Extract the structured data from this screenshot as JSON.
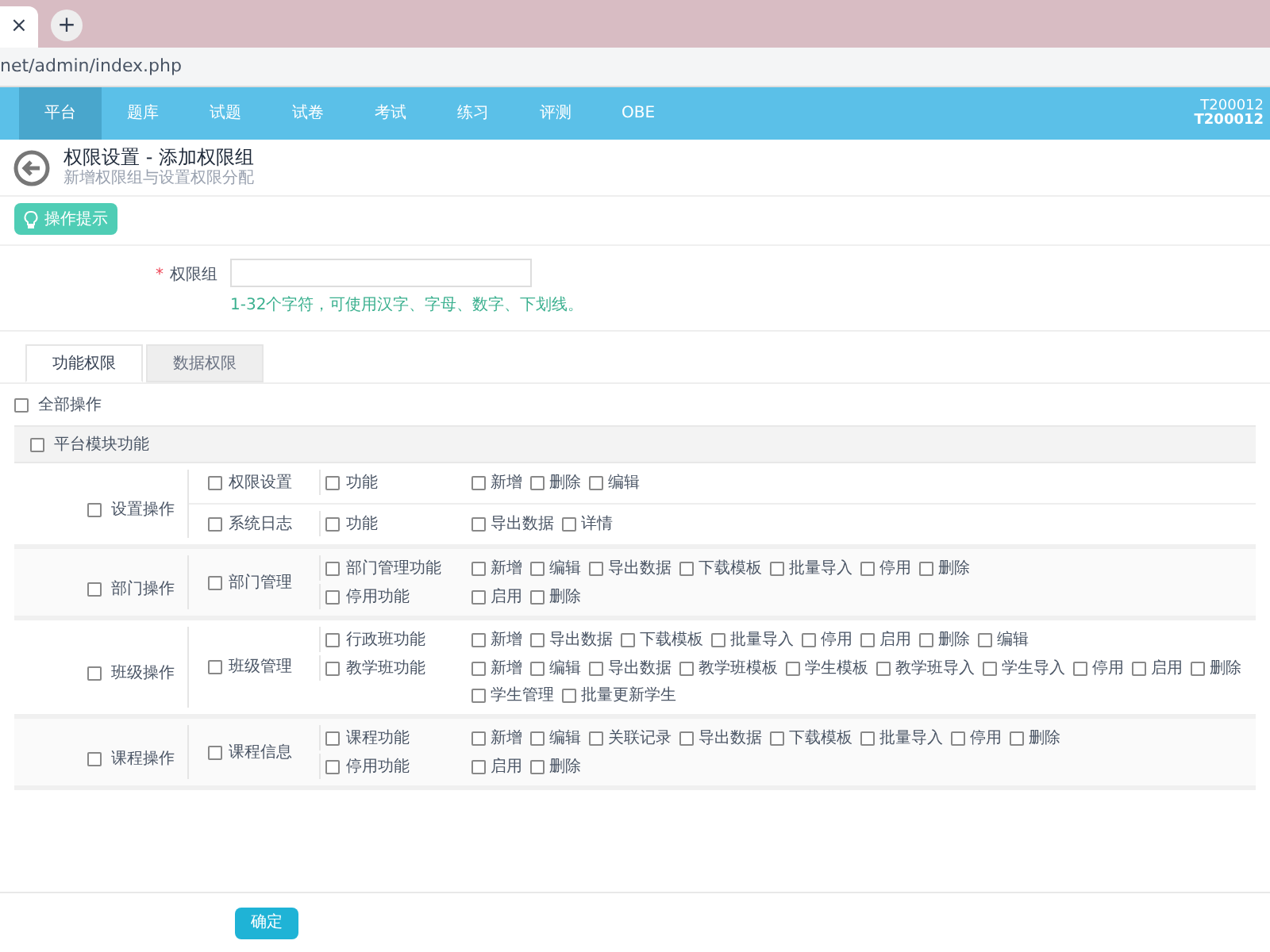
{
  "browser": {
    "tab_close": "×",
    "new_tab": "+",
    "address": "net/admin/index.php"
  },
  "nav": {
    "items": [
      {
        "label": "平台",
        "selected": true
      },
      {
        "label": "题库",
        "selected": false
      },
      {
        "label": "试题",
        "selected": false
      },
      {
        "label": "试卷",
        "selected": false
      },
      {
        "label": "考试",
        "selected": false
      },
      {
        "label": "练习",
        "selected": false
      },
      {
        "label": "评测",
        "selected": false
      },
      {
        "label": "OBE",
        "selected": false
      }
    ],
    "user_id": "T200012",
    "user_name": "T200012"
  },
  "header": {
    "title": "权限设置 - 添加权限组",
    "subtitle": "新增权限组与设置权限分配"
  },
  "tips_button": "操作提示",
  "form": {
    "label": "权限组",
    "required_mark": "*",
    "hint": "1-32个字符，可使用汉字、字母、数字、下划线。"
  },
  "tabs": [
    {
      "label": "功能权限",
      "selected": true
    },
    {
      "label": "数据权限",
      "selected": false
    }
  ],
  "all_ops": {
    "label": "全部操作",
    "checked": false
  },
  "section": {
    "label": "平台模块功能",
    "checked": false
  },
  "groups": [
    {
      "label": "设置操作",
      "checked": false,
      "modules": [
        {
          "label": "权限设置",
          "checked": false,
          "features": [
            {
              "label": "功能",
              "checked": false,
              "actions": [
                {
                  "label": "新增",
                  "checked": false
                },
                {
                  "label": "删除",
                  "checked": false
                },
                {
                  "label": "编辑",
                  "checked": false
                }
              ]
            }
          ]
        },
        {
          "label": "系统日志",
          "checked": false,
          "features": [
            {
              "label": "功能",
              "checked": false,
              "actions": [
                {
                  "label": "导出数据",
                  "checked": false
                },
                {
                  "label": "详情",
                  "checked": false
                }
              ]
            }
          ]
        }
      ]
    },
    {
      "label": "部门操作",
      "checked": false,
      "modules": [
        {
          "label": "部门管理",
          "checked": false,
          "features": [
            {
              "label": "部门管理功能",
              "checked": false,
              "actions": [
                {
                  "label": "新增",
                  "checked": false
                },
                {
                  "label": "编辑",
                  "checked": false
                },
                {
                  "label": "导出数据",
                  "checked": false
                },
                {
                  "label": "下载模板",
                  "checked": false
                },
                {
                  "label": "批量导入",
                  "checked": false
                },
                {
                  "label": "停用",
                  "checked": false
                },
                {
                  "label": "删除",
                  "checked": false
                }
              ]
            },
            {
              "label": "停用功能",
              "checked": false,
              "actions": [
                {
                  "label": "启用",
                  "checked": false
                },
                {
                  "label": "删除",
                  "checked": false
                }
              ]
            }
          ]
        }
      ]
    },
    {
      "label": "班级操作",
      "checked": false,
      "modules": [
        {
          "label": "班级管理",
          "checked": false,
          "features": [
            {
              "label": "行政班功能",
              "checked": false,
              "actions": [
                {
                  "label": "新增",
                  "checked": false
                },
                {
                  "label": "导出数据",
                  "checked": false
                },
                {
                  "label": "下载模板",
                  "checked": false
                },
                {
                  "label": "批量导入",
                  "checked": false
                },
                {
                  "label": "停用",
                  "checked": false
                },
                {
                  "label": "启用",
                  "checked": false
                },
                {
                  "label": "删除",
                  "checked": false
                },
                {
                  "label": "编辑",
                  "checked": false
                }
              ]
            },
            {
              "label": "教学班功能",
              "checked": false,
              "actions": [
                {
                  "label": "新增",
                  "checked": false
                },
                {
                  "label": "编辑",
                  "checked": false
                },
                {
                  "label": "导出数据",
                  "checked": false
                },
                {
                  "label": "教学班模板",
                  "checked": false
                },
                {
                  "label": "学生模板",
                  "checked": false
                },
                {
                  "label": "教学班导入",
                  "checked": false
                },
                {
                  "label": "学生导入",
                  "checked": false
                },
                {
                  "label": "停用",
                  "checked": false
                },
                {
                  "label": "启用",
                  "checked": false
                },
                {
                  "label": "删除",
                  "checked": false
                },
                {
                  "label": "学生管理",
                  "checked": false
                },
                {
                  "label": "批量更新学生",
                  "checked": false
                }
              ]
            }
          ]
        }
      ]
    },
    {
      "label": "课程操作",
      "checked": false,
      "modules": [
        {
          "label": "课程信息",
          "checked": false,
          "features": [
            {
              "label": "课程功能",
              "checked": false,
              "actions": [
                {
                  "label": "新增",
                  "checked": false
                },
                {
                  "label": "编辑",
                  "checked": false
                },
                {
                  "label": "关联记录",
                  "checked": false
                },
                {
                  "label": "导出数据",
                  "checked": false
                },
                {
                  "label": "下载模板",
                  "checked": false
                },
                {
                  "label": "批量导入",
                  "checked": false
                },
                {
                  "label": "停用",
                  "checked": false
                },
                {
                  "label": "删除",
                  "checked": false
                }
              ]
            },
            {
              "label": "停用功能",
              "checked": false,
              "actions": [
                {
                  "label": "启用",
                  "checked": false
                },
                {
                  "label": "删除",
                  "checked": false
                }
              ]
            }
          ]
        }
      ]
    }
  ],
  "confirm_button": "确定"
}
